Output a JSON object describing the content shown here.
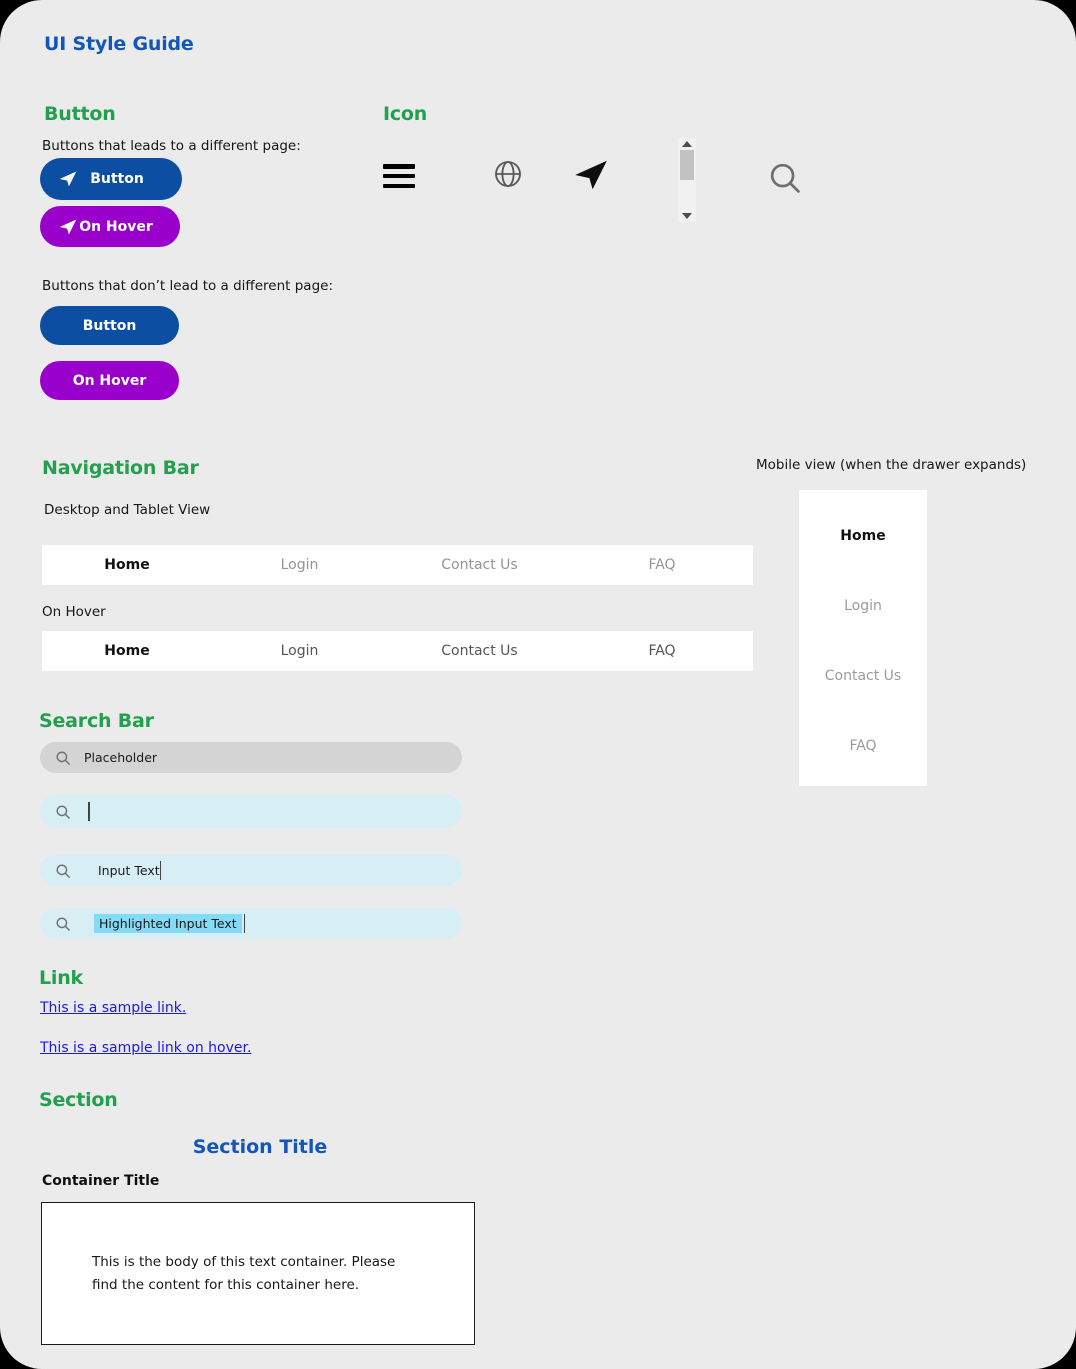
{
  "page": {
    "title": "UI Style Guide",
    "background": "#ebebeb",
    "title_color": "#1456b8",
    "section_heading_color": "#22a04d"
  },
  "button_section": {
    "heading": "Button",
    "nav_caption": "Buttons that leads to a different page:",
    "static_caption": "Buttons that don’t lead to a different page:",
    "colors": {
      "default": "#0b4ea2",
      "hover": "#9900cc",
      "label": "#ffffff"
    },
    "nav_buttons": [
      {
        "label": "Button",
        "icon": "paper-plane-icon",
        "state": "default"
      },
      {
        "label": "On Hover",
        "icon": "paper-plane-icon",
        "state": "hover"
      }
    ],
    "static_buttons": [
      {
        "label": "Button",
        "state": "default"
      },
      {
        "label": "On Hover",
        "state": "hover"
      }
    ]
  },
  "icon_section": {
    "heading": "Icon",
    "icons": [
      "hamburger-menu-icon",
      "globe-icon",
      "paper-plane-icon",
      "vertical-scrollbar",
      "search-icon"
    ]
  },
  "nav_section": {
    "heading": "Navigation Bar",
    "desktop_caption": "Desktop and Tablet View",
    "hover_caption": "On Hover",
    "mobile_caption": "Mobile view (when the drawer expands)",
    "items": [
      "Home",
      "Login",
      "Contact Us",
      "FAQ"
    ],
    "active_item": "Home",
    "idle_color_default": "#949494",
    "idle_color_hover": "#555555"
  },
  "search_section": {
    "heading": "Search Bar",
    "bars": [
      {
        "state": "placeholder",
        "text": "Placeholder",
        "background": "#d4d4d4"
      },
      {
        "state": "empty-focused",
        "text": "",
        "background": "#d7eef5"
      },
      {
        "state": "typed",
        "text": "Input Text",
        "background": "#d7eef5"
      },
      {
        "state": "highlighted",
        "text": "Highlighted Input Text",
        "background": "#d7eef5",
        "selection_color": "#85dbf5"
      }
    ]
  },
  "link_section": {
    "heading": "Link",
    "default_link": "This is a sample link.",
    "hover_link": "This is a sample link on hover.",
    "color": "#1a1ae6"
  },
  "section_section": {
    "heading": "Section",
    "section_title": "Section Title",
    "container_title": "Container Title",
    "container_body": "This is the body of this text container. Please find the content for this container here."
  }
}
